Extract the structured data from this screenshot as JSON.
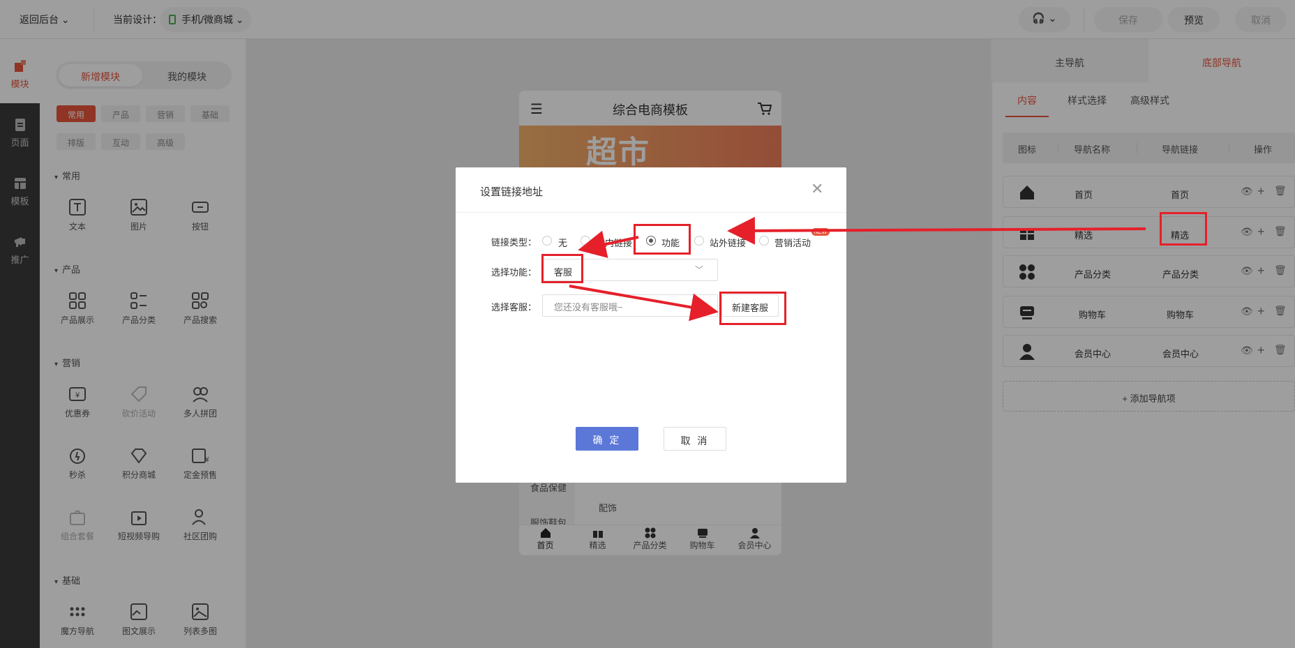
{
  "topbar": {
    "back_label": "返回后台",
    "design_label": "当前设计：",
    "device_label": "手机/微商城",
    "save": "保存",
    "preview": "预览",
    "cancel": "取消"
  },
  "rail": {
    "items": [
      {
        "label": "模块",
        "icon": "blocks-icon"
      },
      {
        "label": "页面",
        "icon": "page-icon"
      },
      {
        "label": "模板",
        "icon": "template-icon"
      },
      {
        "label": "推广",
        "icon": "megaphone-icon"
      }
    ]
  },
  "module_panel": {
    "seg_new": "新增模块",
    "seg_mine": "我的模块",
    "chips": [
      "常用",
      "产品",
      "营销",
      "基础",
      "排版",
      "互动",
      "高级"
    ],
    "sections": {
      "common": {
        "title": "常用",
        "items": [
          "文本",
          "图片",
          "按钮"
        ]
      },
      "product": {
        "title": "产品",
        "items": [
          "产品展示",
          "产品分类",
          "产品搜索"
        ]
      },
      "marketing": {
        "title": "营销",
        "items": [
          "优惠券",
          "砍价活动",
          "多人拼团",
          "秒杀",
          "积分商城",
          "定金预售",
          "组合套餐",
          "短视频导购",
          "社区团购"
        ]
      },
      "basic": {
        "title": "基础",
        "items": [
          "魔方导航",
          "图文展示",
          "列表多图"
        ]
      }
    }
  },
  "phone": {
    "title": "综合电商模板",
    "banner_text": "超市",
    "cat_left_1": "食品保健",
    "cat_left_2": "服饰鞋包",
    "cat_right": "配饰",
    "tabs": [
      "首页",
      "精选",
      "产品分类",
      "购物车",
      "会员中心"
    ]
  },
  "right_panel": {
    "tabs": [
      "主导航",
      "底部导航"
    ],
    "subtabs": [
      "内容",
      "样式选择",
      "高级样式"
    ],
    "headers": [
      "图标",
      "导航名称",
      "导航链接",
      "操作"
    ],
    "rows": [
      {
        "name": "首页",
        "link": "首页",
        "icon": "home-icon"
      },
      {
        "name": "精选",
        "link": "精选",
        "icon": "gift-icon"
      },
      {
        "name": "产品分类",
        "link": "产品分类",
        "icon": "grid-icon"
      },
      {
        "name": "购物车",
        "link": "购物车",
        "icon": "cart-icon"
      },
      {
        "name": "会员中心",
        "link": "会员中心",
        "icon": "user-icon"
      }
    ],
    "add_label": "+ 添加导航项"
  },
  "modal": {
    "title": "设置链接地址",
    "link_type_label": "链接类型：",
    "link_types": [
      "无",
      "站内链接",
      "功能",
      "站外链接",
      "营销活动"
    ],
    "selected_type": "功能",
    "badge": "NEW",
    "function_label": "选择功能：",
    "function_value": "客服",
    "service_label": "选择客服：",
    "service_placeholder": "您还没有客服哦~",
    "new_service": "新建客服",
    "ok": "确 定",
    "cancel": "取 消"
  },
  "colors": {
    "accent": "#e8553d",
    "primary_button": "#5b78d8",
    "annotation_red": "#e5202a"
  }
}
